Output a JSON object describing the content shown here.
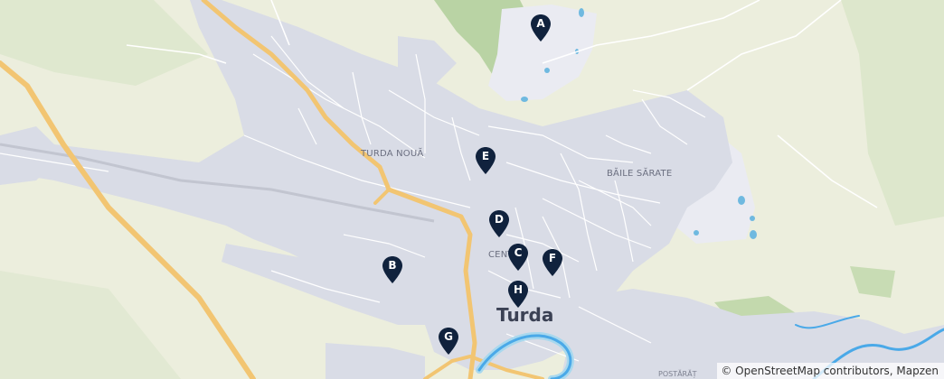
{
  "map": {
    "labels": {
      "turda_noua": "TURDA NOUĂ",
      "baile_sarate": "BĂILE SĂRATE",
      "centru": "CENTRU",
      "turda": "Turda",
      "potarat": "POSTĂRĂȚ"
    },
    "markers": [
      {
        "letter": "A"
      },
      {
        "letter": "B"
      },
      {
        "letter": "C"
      },
      {
        "letter": "D"
      },
      {
        "letter": "E"
      },
      {
        "letter": "F"
      },
      {
        "letter": "G"
      },
      {
        "letter": "H"
      }
    ],
    "attribution": "© OpenStreetMap contributors, Mapzen",
    "colors": {
      "land": "#eceedd",
      "urban": "#d9dce6",
      "road_major": "#f2c572",
      "park": "#b9d3a4",
      "water": "#6fb9e0",
      "river": "#4aa9e8",
      "marker": "#10223d"
    }
  }
}
